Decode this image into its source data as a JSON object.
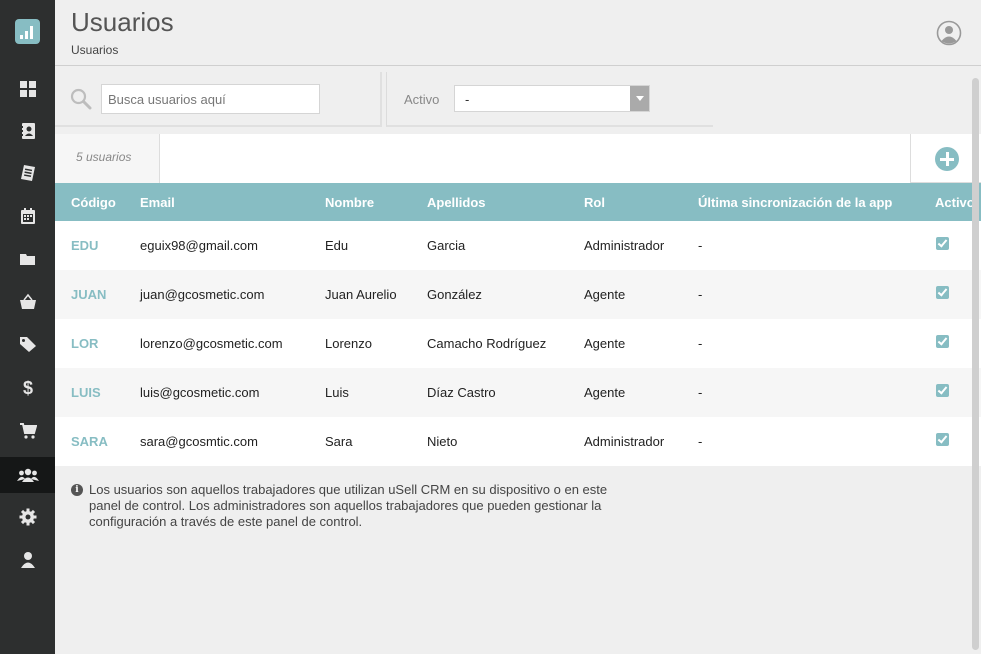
{
  "header": {
    "title": "Usuarios",
    "breadcrumb": "Usuarios"
  },
  "sidebar": {
    "items": [
      {
        "icon": "dashboard-icon"
      },
      {
        "icon": "contacts-icon"
      },
      {
        "icon": "notes-icon"
      },
      {
        "icon": "calendar-icon"
      },
      {
        "icon": "folder-icon"
      },
      {
        "icon": "basket-icon"
      },
      {
        "icon": "tag-icon"
      },
      {
        "icon": "dollar-icon"
      },
      {
        "icon": "cart-icon"
      },
      {
        "icon": "users-icon",
        "active": true
      },
      {
        "icon": "gear-icon"
      },
      {
        "icon": "user-icon"
      }
    ]
  },
  "search": {
    "placeholder": "Busca usuarios aquí"
  },
  "filter": {
    "active_label": "Activo",
    "active_value": "-"
  },
  "list": {
    "count_label": "5 usuarios"
  },
  "table": {
    "columns": [
      "Código",
      "Email",
      "Nombre",
      "Apellidos",
      "Rol",
      "Última sincronización de la app",
      "Activo"
    ],
    "rows": [
      [
        "EDU",
        "eguix98@gmail.com",
        "Edu",
        "Garcia",
        "Administrador",
        "-"
      ],
      [
        "JUAN",
        "juan@gcosmetic.com",
        "Juan Aurelio",
        "González",
        "Agente",
        "-"
      ],
      [
        "LOR",
        "lorenzo@gcosmetic.com",
        "Lorenzo",
        "Camacho Rodríguez",
        "Agente",
        "-"
      ],
      [
        "LUIS",
        "luis@gcosmetic.com",
        "Luis",
        "Díaz Castro",
        "Agente",
        "-"
      ],
      [
        "SARA",
        "sara@gcosmtic.com",
        "Sara",
        "Nieto",
        "Administrador",
        "-"
      ]
    ],
    "active": [
      true,
      true,
      true,
      true,
      true
    ]
  },
  "info": {
    "icon": "i",
    "text": "Los usuarios son aquellos trabajadores que utilizan uSell CRM en su dispositivo o en este panel de control. Los administradores son aquellos trabajadores que pueden gestionar la configuración a través de este panel de control."
  },
  "colors": {
    "accent": "#87bdc3",
    "sidebar": "#2d2f2f",
    "sidebar_active": "#151717"
  }
}
